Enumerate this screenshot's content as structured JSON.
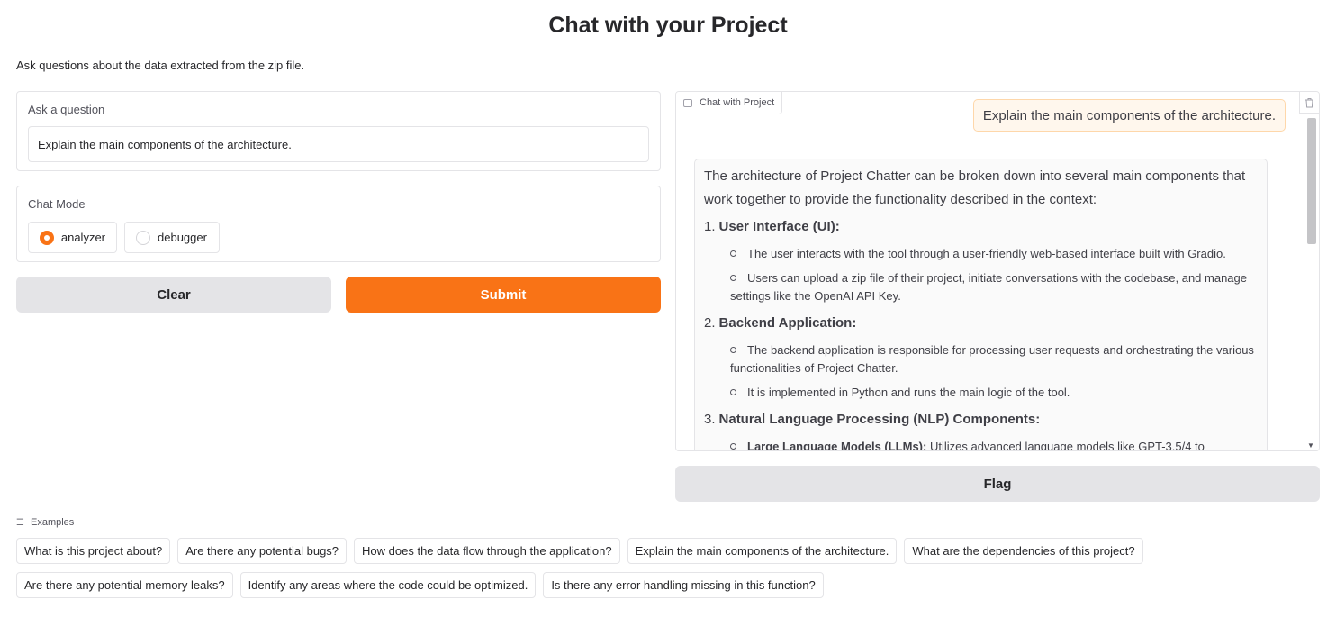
{
  "page": {
    "title": "Chat with your Project",
    "description": "Ask questions about the data extracted from the zip file."
  },
  "question": {
    "label": "Ask a question",
    "value": "Explain the main components of the architecture."
  },
  "chat_mode": {
    "label": "Chat Mode",
    "options": [
      "analyzer",
      "debugger"
    ],
    "selected": "analyzer"
  },
  "buttons": {
    "clear": "Clear",
    "submit": "Submit",
    "flag": "Flag"
  },
  "chatbot": {
    "label": "Chat with Project",
    "user_message": "Explain the main components of the architecture.",
    "bot_intro": "The architecture of Project Chatter can be broken down into several main components that work together to provide the functionality described in the context:",
    "sections": [
      {
        "number": "1.",
        "title": "User Interface (UI):",
        "bullets": [
          "The user interacts with the tool through a user-friendly web-based interface built with Gradio.",
          "Users can upload a zip file of their project, initiate conversations with the codebase, and manage settings like the OpenAI API Key."
        ]
      },
      {
        "number": "2.",
        "title": "Backend Application:",
        "bullets": [
          "The backend application is responsible for processing user requests and orchestrating the various functionalities of Project Chatter.",
          "It is implemented in Python and runs the main logic of the tool."
        ]
      },
      {
        "number": "3.",
        "title": "Natural Language Processing (NLP) Components:",
        "bullets": []
      }
    ],
    "cut_off_bullet": {
      "bold": "Large Language Models (LLMs):",
      "text": " Utilizes advanced language models like GPT-3.5/4 to"
    }
  },
  "examples": {
    "label": "Examples",
    "row1": [
      "What is this project about?",
      "Are there any potential bugs?",
      "How does the data flow through the application?",
      "Explain the main components of the architecture.",
      "What are the dependencies of this project?"
    ],
    "row2": [
      "Are there any potential memory leaks?",
      "Identify any areas where the code could be optimized.",
      "Is there any error handling missing in this function?"
    ]
  },
  "colors": {
    "accent": "#f97316",
    "user_bubble": "#fff7ed",
    "secondary_button": "#e4e4e7"
  }
}
